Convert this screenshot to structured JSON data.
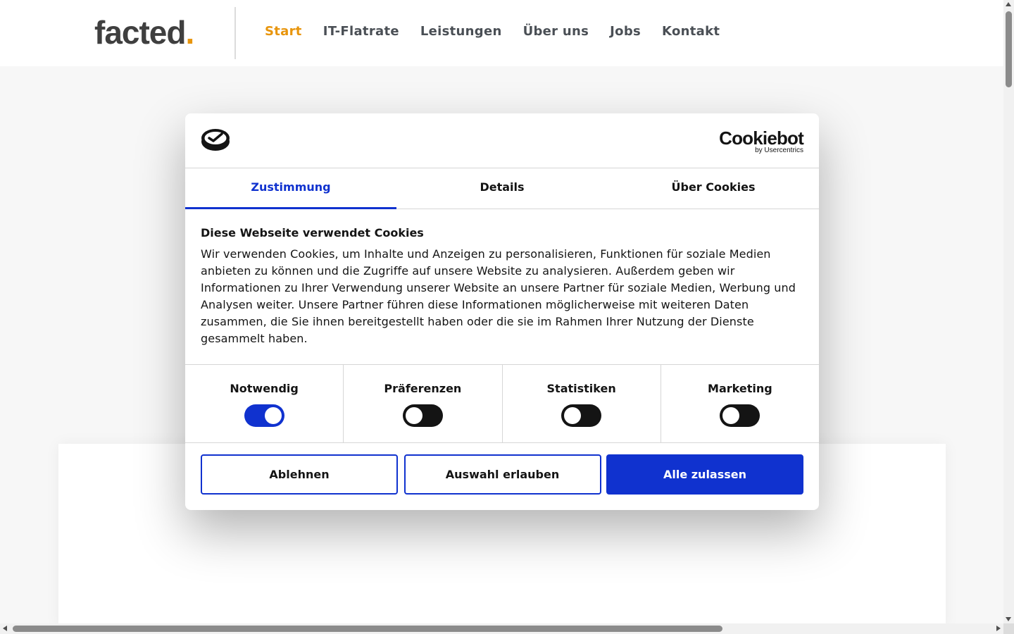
{
  "header": {
    "logo_text": "facted",
    "logo_dot": ".",
    "logo_dot_color": "#e8950c",
    "nav": [
      {
        "label": "Start",
        "active": true
      },
      {
        "label": "IT-Flatrate",
        "active": false
      },
      {
        "label": "Leistungen",
        "active": false
      },
      {
        "label": "Über uns",
        "active": false
      },
      {
        "label": "Jobs",
        "active": false
      },
      {
        "label": "Kontakt",
        "active": false
      }
    ]
  },
  "cookie_dialog": {
    "brand_name": "Cookiebot",
    "brand_sub": "by Usercentrics",
    "logo_icon": "cookiebot-logo-icon",
    "tabs": [
      {
        "label": "Zustimmung",
        "active": true
      },
      {
        "label": "Details",
        "active": false
      },
      {
        "label": "Über Cookies",
        "active": false
      }
    ],
    "title": "Diese Webseite verwendet Cookies",
    "text": "Wir verwenden Cookies, um Inhalte und Anzeigen zu personalisieren, Funktionen für soziale Medien anbieten zu können und die Zugriffe auf unsere Website zu analysieren. Außerdem geben wir Informationen zu Ihrer Verwendung unserer Website an unsere Partner für soziale Medien, Werbung und Analysen weiter. Unsere Partner führen diese Informationen möglicherweise mit weiteren Daten zusammen, die Sie ihnen bereitgestellt haben oder die sie im Rahmen Ihrer Nutzung der Dienste gesammelt haben.",
    "consents": [
      {
        "label": "Notwendig",
        "checked": true
      },
      {
        "label": "Präferenzen",
        "checked": false
      },
      {
        "label": "Statistiken",
        "checked": false
      },
      {
        "label": "Marketing",
        "checked": false
      }
    ],
    "buttons": {
      "decline": "Ablehnen",
      "allow_selection": "Auswahl erlauben",
      "allow_all": "Alle zulassen"
    },
    "accent_color": "#1032cf"
  }
}
